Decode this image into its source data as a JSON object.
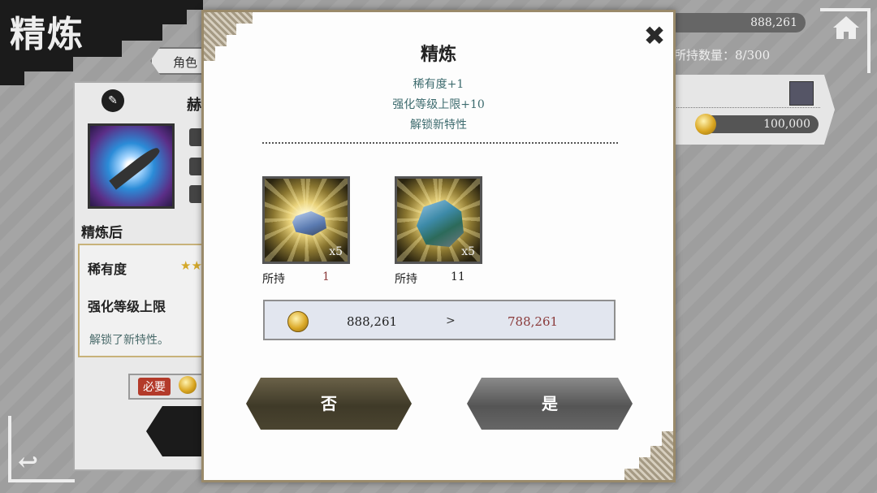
{
  "screen": {
    "title": "精炼",
    "tab_fragment": "角色",
    "currency_amount": "888,261",
    "capacity": "所持数量：8/300",
    "right_card_cost": "100,000"
  },
  "left_panel": {
    "name_fragment": "赫",
    "after_label": "精炼后",
    "rarity_label": "稀有度",
    "enhance_label": "强化等级上限",
    "unlock_text": "解锁了新特性。",
    "required_label": "必要"
  },
  "dialog": {
    "title": "精炼",
    "effects": [
      "稀有度+1",
      "强化等级上限+10",
      "解锁新特性"
    ],
    "materials": [
      {
        "icon": "blue-ore-icon",
        "quantity": "x5",
        "owned_label": "所持",
        "owned": "1",
        "owned_color": "#8a3a3a"
      },
      {
        "icon": "green-ore-icon",
        "quantity": "x5",
        "owned_label": "所持",
        "owned": "11",
        "owned_color": "#222222"
      }
    ],
    "cost": {
      "from": "888,261",
      "arrow": ">",
      "to": "788,261"
    },
    "no_label": "否",
    "yes_label": "是",
    "close_icon": "close-icon"
  },
  "colors": {
    "accent_text": "#3d6b6e",
    "insufficient": "#8a3a3a",
    "no_button": "#4a4430",
    "yes_button": "#666666"
  }
}
